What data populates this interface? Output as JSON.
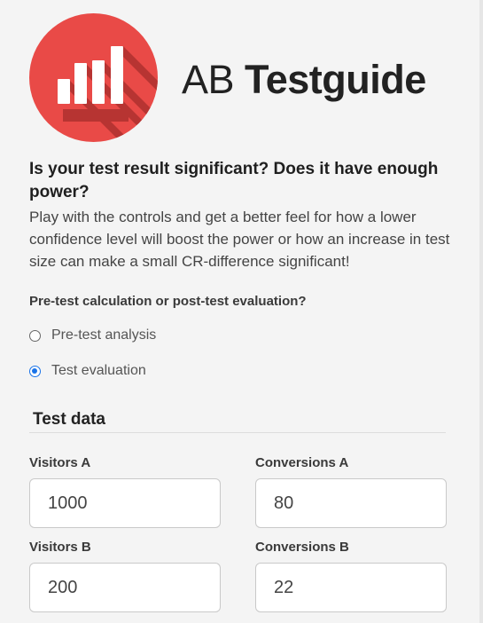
{
  "brand": {
    "name_regular": "AB",
    "name_bold": "Testguide",
    "logo_color": "#e94a47",
    "logo_shadow_color": "#b73432"
  },
  "headline": "Is your test result significant? Does it have enough power?",
  "intro": "Play with the controls and get a better feel for how a lower confidence level will boost the power or how an increase in test size can make a small CR-difference significant!",
  "mode": {
    "question": "Pre-test calculation or post-test evaluation?",
    "options": [
      {
        "label": "Pre-test analysis",
        "selected": false
      },
      {
        "label": "Test evaluation",
        "selected": true
      }
    ]
  },
  "test_data": {
    "title": "Test data",
    "visitors_a": {
      "label": "Visitors A",
      "value": "1000"
    },
    "conversions_a": {
      "label": "Conversions A",
      "value": "80"
    },
    "visitors_b": {
      "label": "Visitors B",
      "value": "200"
    },
    "conversions_b": {
      "label": "Conversions B",
      "value": "22"
    }
  }
}
